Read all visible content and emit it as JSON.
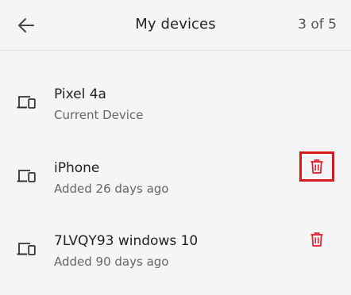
{
  "header": {
    "title": "My devices",
    "counter": "3 of 5",
    "back_icon": "arrow-left-icon"
  },
  "devices": [
    {
      "name": "Pixel 4a",
      "subtitle": "Current Device",
      "icon": "devices-icon",
      "deletable": false
    },
    {
      "name": "iPhone",
      "subtitle": "Added 26 days ago",
      "icon": "devices-icon",
      "deletable": true,
      "highlighted": true
    },
    {
      "name": "7LVQY93 windows 10",
      "subtitle": "Added 90 days ago",
      "icon": "devices-icon",
      "deletable": true,
      "highlighted": false
    }
  ],
  "colors": {
    "background": "#f5f5f5",
    "delete_icon": "#e4172b",
    "highlight_border": "#d71a1f"
  }
}
